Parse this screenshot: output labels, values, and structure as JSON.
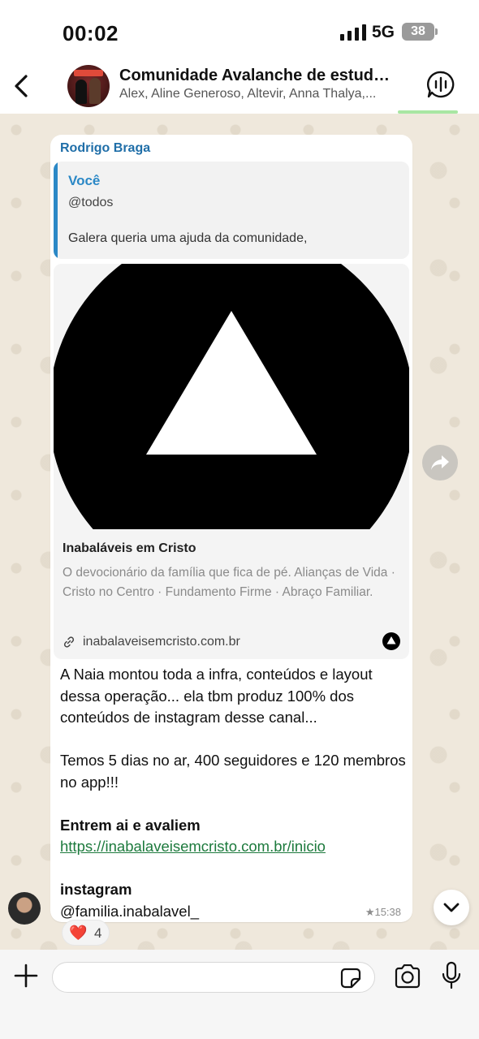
{
  "status_bar": {
    "time": "00:02",
    "network": "5G",
    "battery": "38"
  },
  "header": {
    "title": "Comunidade Avalanche de estudo...",
    "members": "Alex, Aline Generoso, Altevir, Anna Thalya,..."
  },
  "message": {
    "sender": "Rodrigo Braga",
    "quote": {
      "author": "Você",
      "line1": "@todos",
      "line2": "Galera queria uma ajuda da comunidade,"
    },
    "link_preview": {
      "title": "Inabaláveis em Cristo",
      "description": "O devocionário da família que fica de pé. Alianças de Vida · Cristo no Centro · Fundamento Firme · Abraço Familiar.",
      "domain": "inabalaveisemcristo.com.br"
    },
    "paragraph1": "A Naia montou toda a infra, conteúdos e layout dessa operação... ela tbm produz 100% dos conteúdos de instagram desse canal...",
    "paragraph2": "Temos 5 dias no ar, 400 seguidores e 120 membros no app!!!",
    "heading1": "Entrem ai e avaliem",
    "url": "https://inabalaveisemcristo.com.br/inicio",
    "heading2": "instagram",
    "handle": "@familia.inabalavel_",
    "time": "★15:38",
    "reaction": {
      "emoji": "❤️",
      "count": "4"
    }
  },
  "input": {
    "placeholder": ""
  },
  "colors": {
    "sender": "#1f6ea8",
    "quote_accent": "#2b88c6",
    "link": "#1d7a3d",
    "heart": "#e0243a"
  },
  "icons": [
    "back-chevron-icon",
    "voice-chat-icon",
    "link-icon",
    "brand-triangle-icon",
    "forward-icon",
    "chevron-down-icon",
    "plus-icon",
    "sticker-icon",
    "camera-icon",
    "mic-icon"
  ]
}
